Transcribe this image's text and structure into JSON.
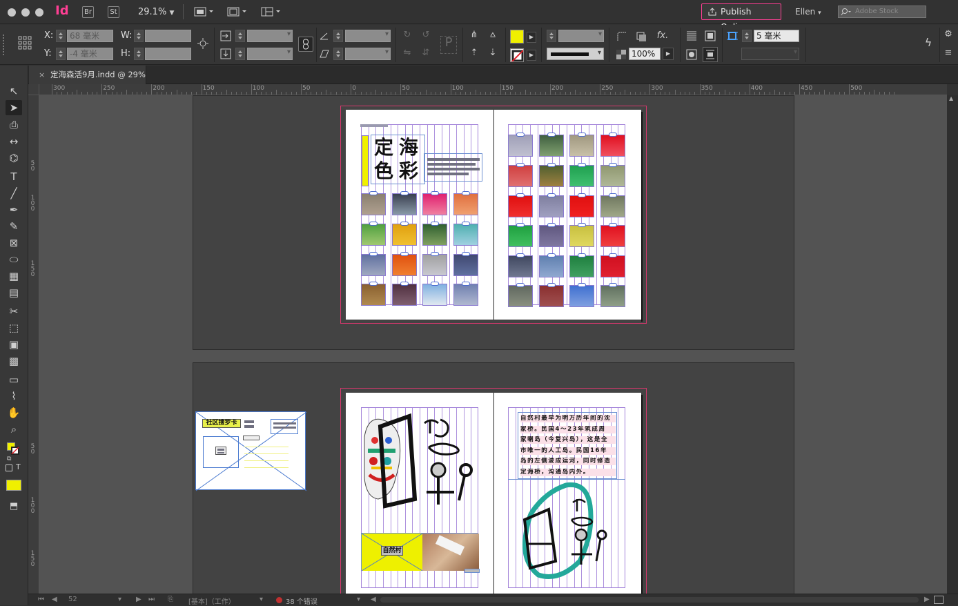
{
  "app": {
    "logo": "Id",
    "bridge": "Br",
    "stock_app": "St",
    "zoom": "29.1%",
    "publish_online": "Publish Online",
    "user": "Ellen",
    "stock_search_placeholder": "Adobe Stock"
  },
  "control": {
    "x_label": "X:",
    "y_label": "Y:",
    "w_label": "W:",
    "h_label": "H:",
    "x_value": "68 毫米",
    "y_value": "-4 毫米",
    "opacity": "100%",
    "stroke_offset": "5 毫米",
    "fill_color": "#f0f000",
    "fx_label": "fx."
  },
  "document": {
    "tab_title": "定海森活9月.indd @ 29%",
    "close_label": "×"
  },
  "ruler": {
    "h_labels": [
      "300",
      "250",
      "200",
      "150",
      "100",
      "50",
      "0",
      "50",
      "100",
      "150",
      "200",
      "250",
      "300",
      "350",
      "400",
      "450",
      "500"
    ],
    "v_labels": [
      "5\n0",
      "1\n0\n0",
      "1\n5\n0",
      "5\n0",
      "1\n0\n0",
      "1\n5\n0"
    ]
  },
  "spread1": {
    "title_chars": [
      "定",
      "海",
      "色",
      "彩"
    ]
  },
  "spread2": {
    "pasteboard_label": "社区搜罗卡",
    "image_label": "自然村",
    "body_text": "自然村最早为明万历年间的沈家桥。民国4～23年筑成周家喇岛（今复兴岛），这是全市唯一的人工岛。民国16年岛的左侧浚成运河，同时修造定海桥，沟通岛内外。",
    "body_lines": [
      "自然村最早为明万历年间的沈",
      "家桥。民国4～23年筑成周",
      "家喇岛（今复兴岛），这是全",
      "市唯一的人工岛。民国16年",
      "岛的左侧浚成运河，同时修造",
      "定海桥，沟通岛内外。"
    ]
  },
  "status": {
    "page_number": "52",
    "master": "[基本]（工作）",
    "errors": "38 个错误"
  },
  "colors": {
    "accent_pink": "#ff3f94",
    "fill_yellow": "#f0f000",
    "guide_purple": "#a07fd8"
  }
}
